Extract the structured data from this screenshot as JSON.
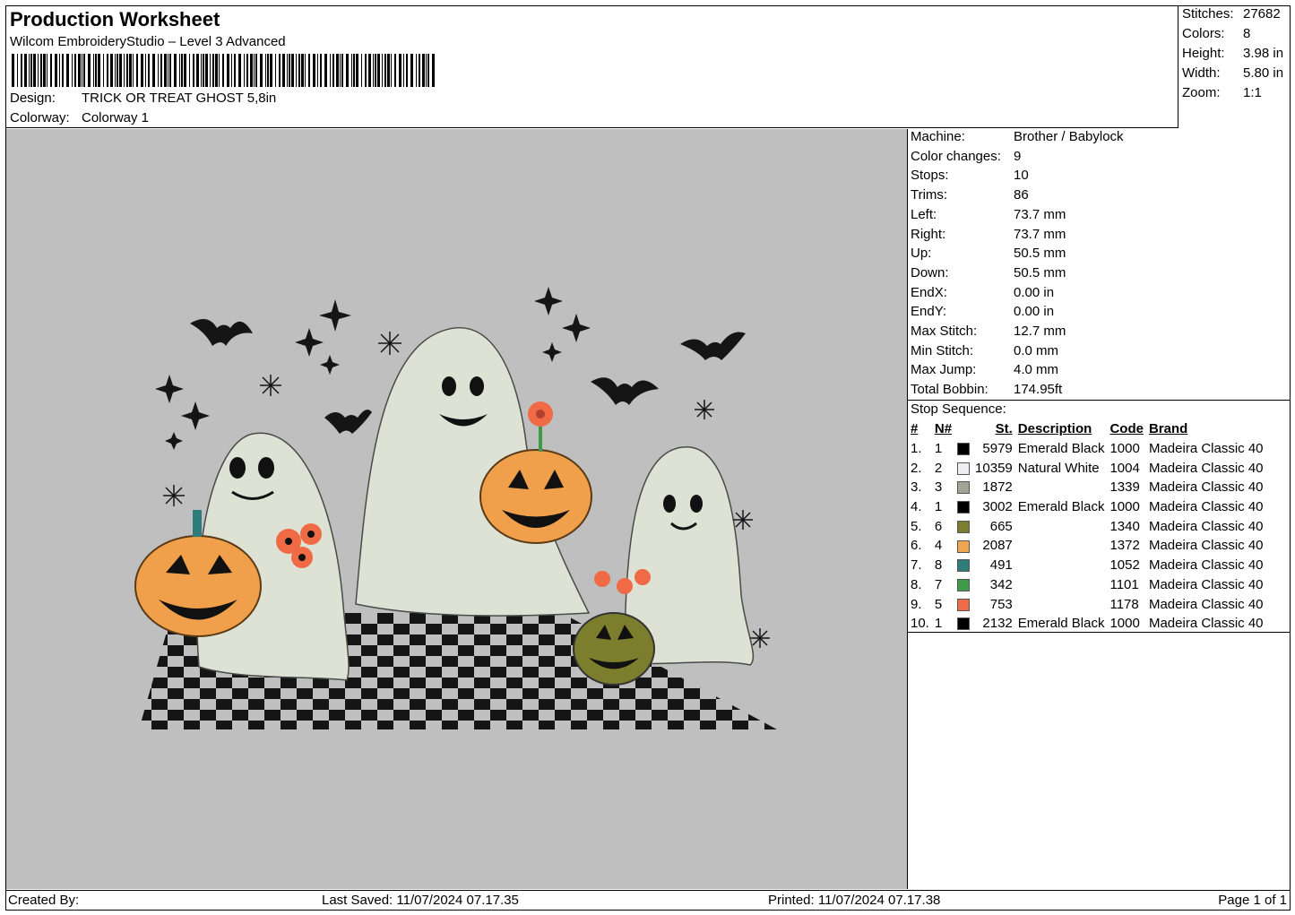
{
  "header": {
    "title": "Production Worksheet",
    "software": "Wilcom EmbroideryStudio – Level 3 Advanced",
    "design_label": "Design:",
    "design_value": "TRICK OR TREAT GHOST 5,8in",
    "colorway_label": "Colorway:",
    "colorway_value": "Colorway 1"
  },
  "summary": {
    "stitches_label": "Stitches:",
    "stitches_value": "27682",
    "colors_label": "Colors:",
    "colors_value": "8",
    "height_label": "Height:",
    "height_value": "3.98 in",
    "width_label": "Width:",
    "width_value": "5.80 in",
    "zoom_label": "Zoom:",
    "zoom_value": "1:1"
  },
  "details": [
    {
      "label": "Machine:",
      "value": "Brother / Babylock"
    },
    {
      "label": "Color changes:",
      "value": "9"
    },
    {
      "label": "Stops:",
      "value": "10"
    },
    {
      "label": "Trims:",
      "value": "86"
    },
    {
      "label": "Left:",
      "value": "73.7 mm"
    },
    {
      "label": "Right:",
      "value": "73.7 mm"
    },
    {
      "label": "Up:",
      "value": "50.5 mm"
    },
    {
      "label": "Down:",
      "value": "50.5 mm"
    },
    {
      "label": "EndX:",
      "value": "0.00 in"
    },
    {
      "label": "EndY:",
      "value": "0.00 in"
    },
    {
      "label": "Max Stitch:",
      "value": "12.7 mm"
    },
    {
      "label": "Min Stitch:",
      "value": "0.0 mm"
    },
    {
      "label": "Max Jump:",
      "value": "4.0 mm"
    },
    {
      "label": "Total Bobbin:",
      "value": "174.95ft"
    }
  ],
  "stop_sequence": {
    "title": "Stop Sequence:",
    "columns": [
      "#",
      "N#",
      "St.",
      "Description",
      "Code",
      "Brand"
    ],
    "rows": [
      {
        "idx": "1.",
        "n": "1",
        "color": "#000000",
        "st": "5979",
        "desc": "Emerald Black",
        "code": "1000",
        "brand": "Madeira Classic 40"
      },
      {
        "idx": "2.",
        "n": "2",
        "color": "#eeeef2",
        "st": "10359",
        "desc": "Natural White",
        "code": "1004",
        "brand": "Madeira Classic 40"
      },
      {
        "idx": "3.",
        "n": "3",
        "color": "#a4a394",
        "st": "1872",
        "desc": "",
        "code": "1339",
        "brand": "Madeira Classic 40"
      },
      {
        "idx": "4.",
        "n": "1",
        "color": "#000000",
        "st": "3002",
        "desc": "Emerald Black",
        "code": "1000",
        "brand": "Madeira Classic 40"
      },
      {
        "idx": "5.",
        "n": "6",
        "color": "#7d7d2e",
        "st": "665",
        "desc": "",
        "code": "1340",
        "brand": "Madeira Classic 40"
      },
      {
        "idx": "6.",
        "n": "4",
        "color": "#f0a551",
        "st": "2087",
        "desc": "",
        "code": "1372",
        "brand": "Madeira Classic 40"
      },
      {
        "idx": "7.",
        "n": "8",
        "color": "#2f7d7a",
        "st": "491",
        "desc": "",
        "code": "1052",
        "brand": "Madeira Classic 40"
      },
      {
        "idx": "8.",
        "n": "7",
        "color": "#3f9a4a",
        "st": "342",
        "desc": "",
        "code": "1101",
        "brand": "Madeira Classic 40"
      },
      {
        "idx": "9.",
        "n": "5",
        "color": "#ef6a45",
        "st": "753",
        "desc": "",
        "code": "1178",
        "brand": "Madeira Classic 40"
      },
      {
        "idx": "10.",
        "n": "1",
        "color": "#000000",
        "st": "2132",
        "desc": "Emerald Black",
        "code": "1000",
        "brand": "Madeira Classic 40"
      }
    ]
  },
  "footer": {
    "created_by": "Created By:",
    "last_saved": "Last Saved: 11/07/2024 07.17.35",
    "printed": "Printed: 11/07/2024 07.17.38",
    "page": "Page 1 of 1"
  },
  "preview": {
    "background": "#bfbfbf",
    "icons": [
      "ghost-icon",
      "pumpkin-icon",
      "bat-icon",
      "star-icon",
      "flower-icon"
    ]
  }
}
